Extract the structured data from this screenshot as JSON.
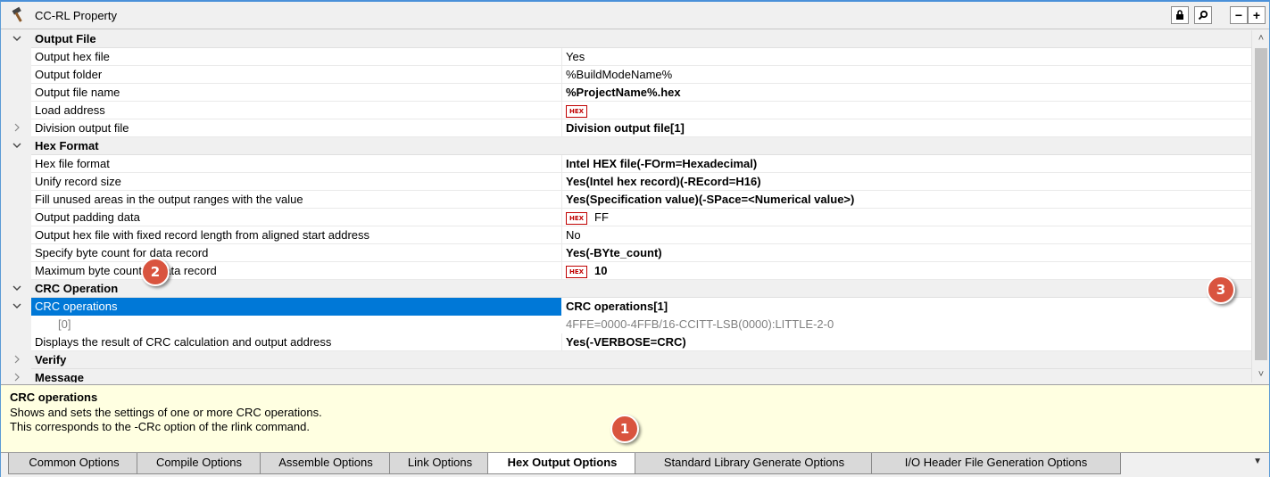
{
  "window": {
    "title": "CC-RL Property"
  },
  "toolbar": {
    "lock_icon": "lock-icon",
    "search_icon": "search-icon",
    "minus_label": "−",
    "plus_label": "+"
  },
  "grid": {
    "rows": [
      {
        "kind": "category",
        "expander": "v",
        "name": "Output File",
        "value": ""
      },
      {
        "kind": "data",
        "name": "Output hex file",
        "value": "Yes",
        "style": "normal"
      },
      {
        "kind": "data",
        "name": "Output folder",
        "value": "%BuildModeName%",
        "style": "normal"
      },
      {
        "kind": "data",
        "name": "Output file name",
        "value": "%ProjectName%.hex",
        "style": "bold"
      },
      {
        "kind": "data",
        "name": "Load address",
        "value": "",
        "hex": "HEX",
        "style": "normal"
      },
      {
        "kind": "data",
        "expander": ">",
        "name": "Division output file",
        "value": "Division output file[1]",
        "style": "bold"
      },
      {
        "kind": "category",
        "expander": "v",
        "name": "Hex Format",
        "value": ""
      },
      {
        "kind": "data",
        "name": "Hex file format",
        "value": "Intel HEX file(-FOrm=Hexadecimal)",
        "style": "bold"
      },
      {
        "kind": "data",
        "name": "Unify record size",
        "value": "Yes(Intel hex record)(-REcord=H16)",
        "style": "bold"
      },
      {
        "kind": "data",
        "name": "Fill unused areas in the output ranges with the value",
        "value": "Yes(Specification value)(-SPace=<Numerical value>)",
        "style": "bold"
      },
      {
        "kind": "data",
        "name": "Output padding data",
        "value": "FF",
        "hex": "HEX",
        "style": "normal"
      },
      {
        "kind": "data",
        "name": "Output hex file with fixed record length from aligned start address",
        "value": "No",
        "style": "normal"
      },
      {
        "kind": "data",
        "name": "Specify byte count for data record",
        "value": "Yes(-BYte_count)",
        "style": "bold"
      },
      {
        "kind": "data",
        "name": "Maximum byte count of data record",
        "value": "10",
        "hex": "HEX",
        "style": "bold"
      },
      {
        "kind": "category",
        "expander": "v",
        "name": "CRC Operation",
        "value": ""
      },
      {
        "kind": "selected",
        "expander": "v",
        "name": "CRC operations",
        "value": "CRC operations[1]",
        "style": "bold"
      },
      {
        "kind": "sub",
        "name": "[0]",
        "value": "4FFE=0000-4FFB/16-CCITT-LSB(0000):LITTLE-2-0",
        "style": "gray"
      },
      {
        "kind": "data",
        "name": "Displays the result of CRC calculation and output address",
        "value": "Yes(-VERBOSE=CRC)",
        "style": "bold"
      },
      {
        "kind": "category",
        "expander": ">",
        "name": "Verify",
        "value": ""
      },
      {
        "kind": "category",
        "expander": ">",
        "name": "Message",
        "value": ""
      }
    ]
  },
  "scrollbar": {
    "up": "˄",
    "down": "˅"
  },
  "description": {
    "title": "CRC operations",
    "line1": "Shows and sets the settings of one or more CRC operations.",
    "line2": "This corresponds to the -CRc option of the rlink command."
  },
  "tabs": [
    {
      "label": "Common Options",
      "active": false
    },
    {
      "label": "Compile Options",
      "active": false
    },
    {
      "label": "Assemble Options",
      "active": false
    },
    {
      "label": "Link Options",
      "active": false
    },
    {
      "label": "Hex Output Options",
      "active": true
    },
    {
      "label": "Standard Library Generate Options",
      "active": false
    },
    {
      "label": "I/O Header File Generation Options",
      "active": false
    }
  ],
  "tab_scroll": "▼",
  "callouts": [
    {
      "label": "1"
    },
    {
      "label": "2"
    },
    {
      "label": "3"
    }
  ],
  "colors": {
    "selection": "#0078d7",
    "callout": "#d9543f",
    "desc_bg": "#ffffe1"
  }
}
